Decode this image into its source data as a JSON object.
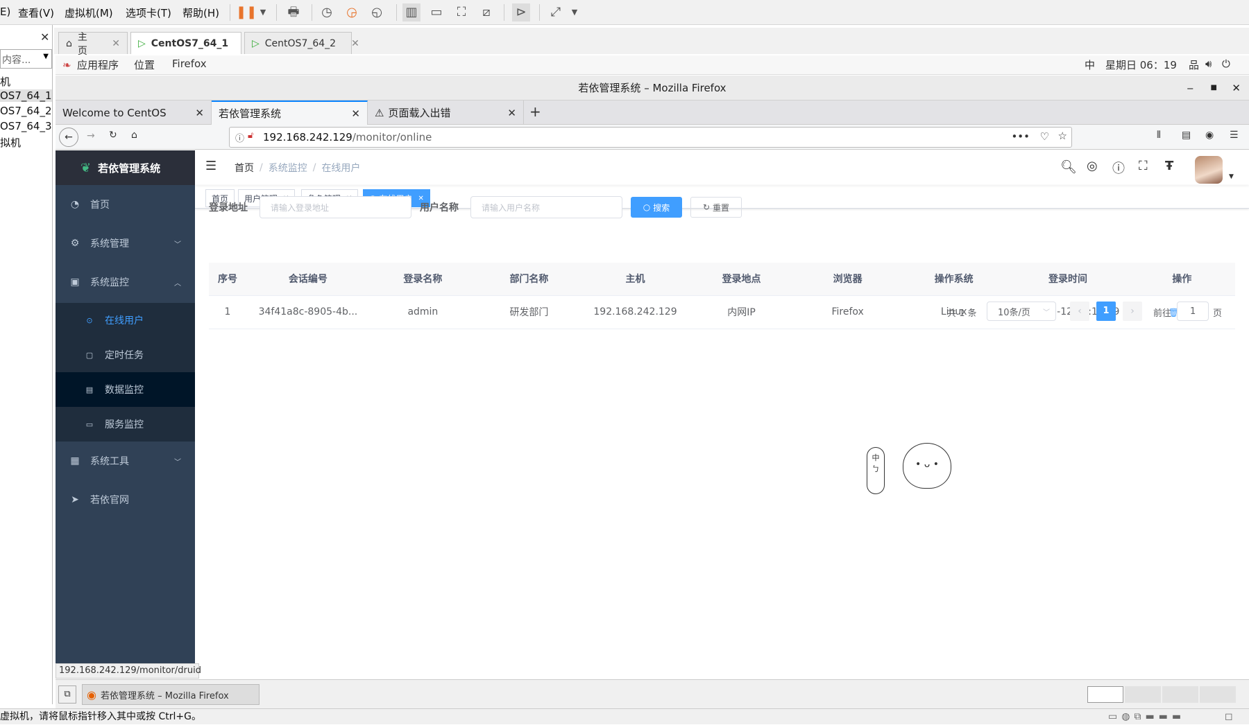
{
  "vm": {
    "menu": [
      "E)",
      "查看(V)",
      "虚拟机(M)",
      "选项卡(T)",
      "帮助(H)"
    ],
    "library": {
      "search_placeholder": "内容...",
      "items": [
        "机",
        "OS7_64_1",
        "OS7_64_2",
        "OS7_64_3",
        "拟机"
      ]
    },
    "tabs": [
      {
        "label": "主页"
      },
      {
        "label": "CentOS7_64_1"
      },
      {
        "label": "CentOS7_64_2"
      }
    ],
    "status_text": "虚拟机，请将鼠标指针移入其中或按 Ctrl+G。"
  },
  "gnome": {
    "apps": "应用程序",
    "places": "位置",
    "firefox": "Firefox",
    "ime": "中",
    "clock": "星期日 06：19",
    "task_label": "若依管理系统 – Mozilla Firefox"
  },
  "firefox": {
    "title": "若依管理系统 – Mozilla Firefox",
    "tabs": [
      {
        "label": "Welcome to CentOS"
      },
      {
        "label": "若依管理系统"
      },
      {
        "label": "页面载入出错"
      }
    ],
    "url_host": "192.168.242.129",
    "url_path": "/monitor/online",
    "status_url": "192.168.242.129/monitor/druid"
  },
  "app": {
    "logo": "若依管理系统",
    "menu": {
      "home": "首页",
      "system": "系统管理",
      "monitor": "系统监控",
      "sub": [
        "在线用户",
        "定时任务",
        "数据监控",
        "服务监控"
      ],
      "tools": "系统工具",
      "site": "若依官网"
    },
    "breadcrumb": [
      "首页",
      "系统监控",
      "在线用户"
    ],
    "tags": [
      {
        "label": "首页"
      },
      {
        "label": "用户管理"
      },
      {
        "label": "角色管理"
      },
      {
        "label": "在线用户"
      }
    ],
    "search": {
      "ip_label": "登录地址",
      "ip_placeholder": "请输入登录地址",
      "user_label": "用户名称",
      "user_placeholder": "请输入用户名称",
      "search_btn": "搜索",
      "reset_btn": "重置"
    },
    "table": {
      "headers": [
        "序号",
        "会话编号",
        "登录名称",
        "部门名称",
        "主机",
        "登录地点",
        "浏览器",
        "操作系统",
        "登录时间",
        "操作"
      ],
      "rows": [
        {
          "no": "1",
          "session": "34f41a8c-8905-4b...",
          "login": "admin",
          "dept": "研发部门",
          "host": "192.168.242.129",
          "location": "内网IP",
          "browser": "Firefox",
          "os": "Linux",
          "time": "2020-07-12 06:18:39",
          "action": "强退"
        }
      ]
    },
    "pager": {
      "total": "共 1 条",
      "size": "10条/页",
      "current": "1",
      "goto": "前往",
      "goto_value": "1",
      "page_suffix": "页"
    },
    "widget": {
      "chars": [
        "中",
        "ㄅ"
      ]
    }
  }
}
